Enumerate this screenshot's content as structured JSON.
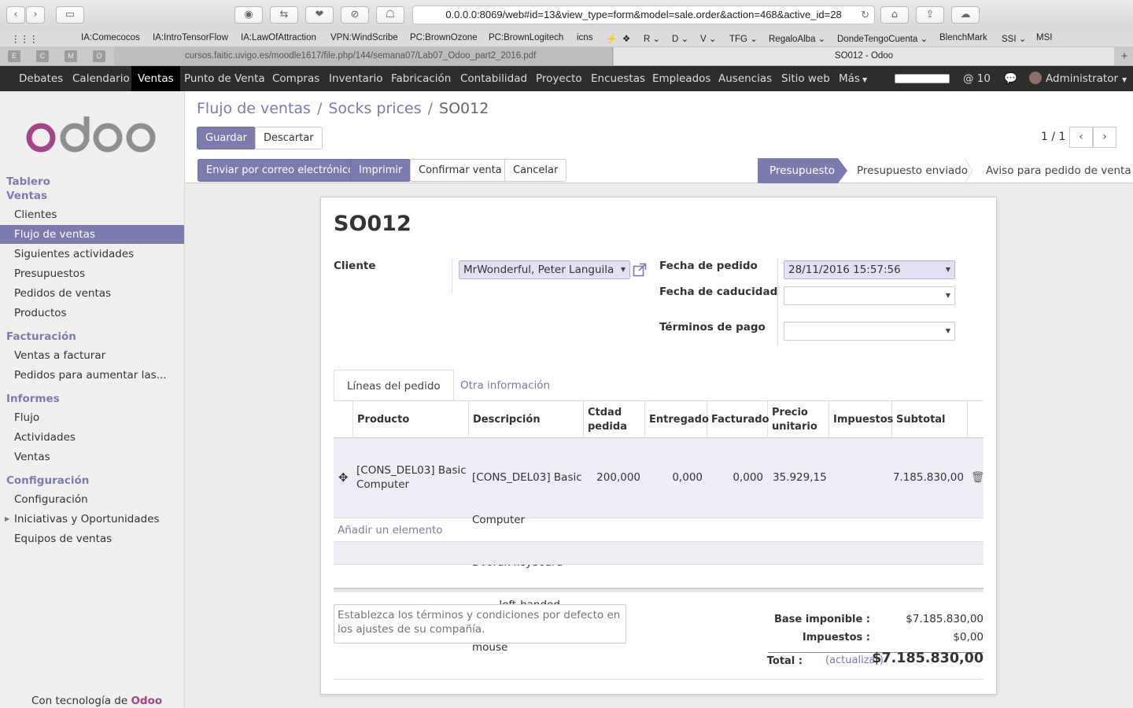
{
  "browser": {
    "url": "0.0.0.0:8069/web#id=13&view_type=form&model=sale.order&action=468&active_id=28",
    "bookmarks": [
      "IA:Comecocos",
      "IA:IntroTensorFlow",
      "IA:LawOfAttraction",
      "VPN:WindScribe",
      "PC:BrownOzone",
      "PC:BrownLogitech",
      "icns",
      "⚡",
      "❖",
      "R ⌄",
      "D ⌄",
      "V ⌄",
      "TFG ⌄",
      "RegaloAlba ⌄",
      "DondeTengoCuenta ⌄",
      "BlenchMark",
      "SSI ⌄",
      "MSI"
    ],
    "pinned_tabs": [
      "E",
      "C",
      "M",
      "O"
    ],
    "tab_inactive": "cursos.faitic.uvigo.es/moodle1617/file.php/144/semana07/Lab07_Odoo_part2_2016.pdf",
    "tab_active": "SO012 - Odoo"
  },
  "topnav": {
    "items": [
      "Debates",
      "Calendario",
      "Ventas",
      "Punto de Venta",
      "Compras",
      "Inventario",
      "Fabricación",
      "Contabilidad",
      "Proyecto",
      "Encuestas",
      "Empleados",
      "Ausencias",
      "Sitio web",
      "Más"
    ],
    "mentions": "@ 10",
    "user": "Administrator"
  },
  "sidebar": {
    "sections": [
      {
        "title": "Tablero",
        "items": []
      },
      {
        "title": "Ventas",
        "items": [
          "Clientes",
          "Flujo de ventas",
          "Siguientes actividades",
          "Presupuestos",
          "Pedidos de ventas",
          "Productos"
        ]
      },
      {
        "title": "Facturación",
        "items": [
          "Ventas a facturar",
          "Pedidos para aumentar las..."
        ]
      },
      {
        "title": "Informes",
        "items": [
          "Flujo",
          "Actividades",
          "Ventas"
        ]
      },
      {
        "title": "Configuración",
        "items": [
          "Configuración",
          "Iniciativas y Oportunidades",
          "Equipos de ventas"
        ]
      }
    ],
    "powered_prefix": "Con tecnología de",
    "powered_brand": "Odoo"
  },
  "control": {
    "breadcrumb": [
      "Flujo de ventas",
      "Socks prices",
      "SO012"
    ],
    "save": "Guardar",
    "discard": "Descartar",
    "pager": "1 / 1",
    "actions": [
      "Enviar por correo electrónico",
      "Imprimir",
      "Confirmar venta",
      "Cancelar"
    ],
    "stages": [
      "Presupuesto",
      "Presupuesto enviado",
      "Aviso para pedido de venta"
    ]
  },
  "form": {
    "title": "SO012",
    "customer_label": "Cliente",
    "customer_value": "MrWonderful, Peter Languila",
    "order_date_label": "Fecha de pedido",
    "order_date_value": "28/11/2016 15:57:56",
    "expiry_label": "Fecha de caducidad",
    "expiry_value": "",
    "terms_label": "Términos de pago",
    "terms_value": "",
    "tabs": [
      "Líneas del pedido",
      "Otra información"
    ],
    "columns": [
      "Producto",
      "Descripción",
      "Ctdad pedida",
      "Entregado",
      "Facturado",
      "Precio unitario",
      "Impuestos",
      "Subtotal"
    ],
    "lines": [
      {
        "product": "[CONS_DEL03] Basic Computer",
        "description": [
          "[CONS_DEL03] Basic",
          "Computer",
          "Dvorak keyboard",
          "        left-handed",
          "mouse"
        ],
        "qty": "200,000",
        "delivered": "0,000",
        "invoiced": "0,000",
        "unit_price": "35.929,15",
        "taxes": "",
        "subtotal": "7.185.830,00"
      }
    ],
    "add_item": "Añadir un elemento",
    "note_placeholder": "Establezca los términos y condiciones por defecto en los ajustes de su compañía.",
    "untaxed_label": "Base imponible :",
    "untaxed_value": "$7.185.830,00",
    "taxes_label": "Impuestos :",
    "taxes_value": "$0,00",
    "total_label": "Total :",
    "update_label": "(actualizar)",
    "total_value": "$7.185.830,00"
  },
  "colors": {
    "accent": "#7c7bad",
    "brand": "#a24689",
    "navbar": "#2d2d2d"
  }
}
